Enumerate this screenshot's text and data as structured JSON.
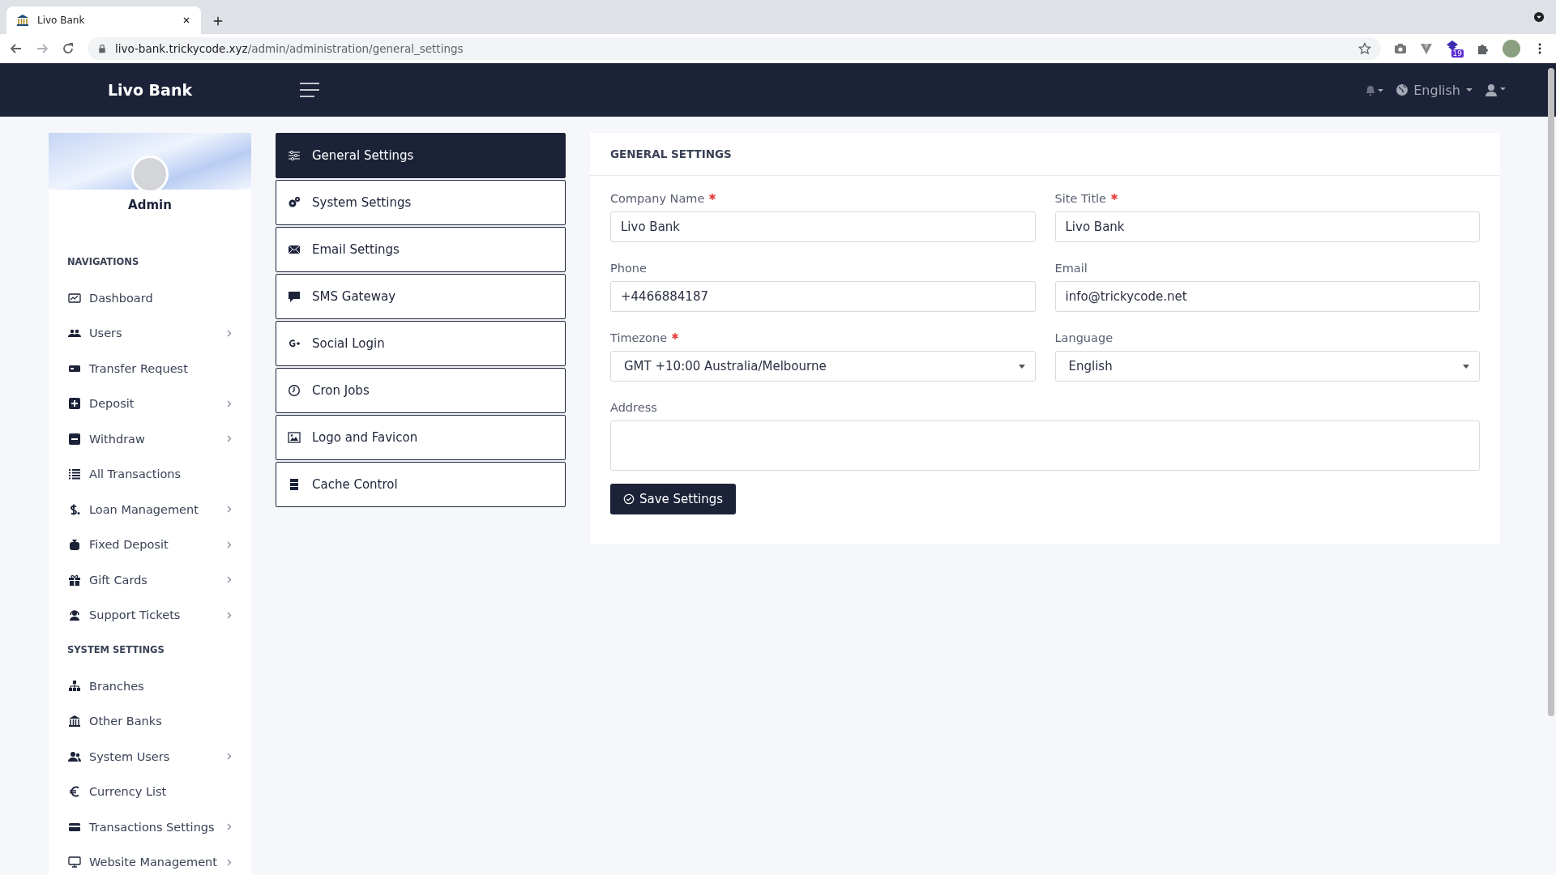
{
  "browser": {
    "tab_title": "Livo Bank",
    "url_host": "livo-bank.trickycode.xyz",
    "url_path": "/admin/administration/general_settings",
    "extension_badge": "19"
  },
  "header": {
    "brand": "Livo Bank",
    "language": "English"
  },
  "sidebar": {
    "user_name": "Admin",
    "sections": [
      {
        "title": "NAVIGATIONS",
        "items": [
          {
            "label": "Dashboard",
            "expandable": false
          },
          {
            "label": "Users",
            "expandable": true
          },
          {
            "label": "Transfer Request",
            "expandable": false
          },
          {
            "label": "Deposit",
            "expandable": true
          },
          {
            "label": "Withdraw",
            "expandable": true
          },
          {
            "label": "All Transactions",
            "expandable": false
          },
          {
            "label": "Loan Management",
            "expandable": true
          },
          {
            "label": "Fixed Deposit",
            "expandable": true
          },
          {
            "label": "Gift Cards",
            "expandable": true
          },
          {
            "label": "Support Tickets",
            "expandable": true
          }
        ]
      },
      {
        "title": "SYSTEM SETTINGS",
        "items": [
          {
            "label": "Branches",
            "expandable": false
          },
          {
            "label": "Other Banks",
            "expandable": false
          },
          {
            "label": "System Users",
            "expandable": true
          },
          {
            "label": "Currency List",
            "expandable": false
          },
          {
            "label": "Transactions Settings",
            "expandable": true
          },
          {
            "label": "Website Management",
            "expandable": true
          }
        ]
      }
    ]
  },
  "settings_menu": {
    "items": [
      {
        "label": "General Settings",
        "selected": true
      },
      {
        "label": "System Settings",
        "selected": false
      },
      {
        "label": "Email Settings",
        "selected": false
      },
      {
        "label": "SMS Gateway",
        "selected": false
      },
      {
        "label": "Social Login",
        "selected": false
      },
      {
        "label": "Cron Jobs",
        "selected": false
      },
      {
        "label": "Logo and Favicon",
        "selected": false
      },
      {
        "label": "Cache Control",
        "selected": false
      }
    ]
  },
  "form": {
    "title": "GENERAL SETTINGS",
    "fields": [
      {
        "kind": "text",
        "label": "Company Name",
        "required": true,
        "value": "Livo Bank"
      },
      {
        "kind": "text",
        "label": "Site Title",
        "required": true,
        "value": "Livo Bank"
      },
      {
        "kind": "text",
        "label": "Phone",
        "required": false,
        "value": "+4466884187"
      },
      {
        "kind": "text",
        "label": "Email",
        "required": false,
        "value": "info@trickycode.net"
      },
      {
        "kind": "select",
        "label": "Timezone",
        "required": true,
        "value": "GMT +10:00 Australia/Melbourne"
      },
      {
        "kind": "select",
        "label": "Language",
        "required": false,
        "value": "English"
      },
      {
        "kind": "textarea",
        "label": "Address",
        "required": false
      }
    ],
    "submit_label": "Save Settings"
  }
}
